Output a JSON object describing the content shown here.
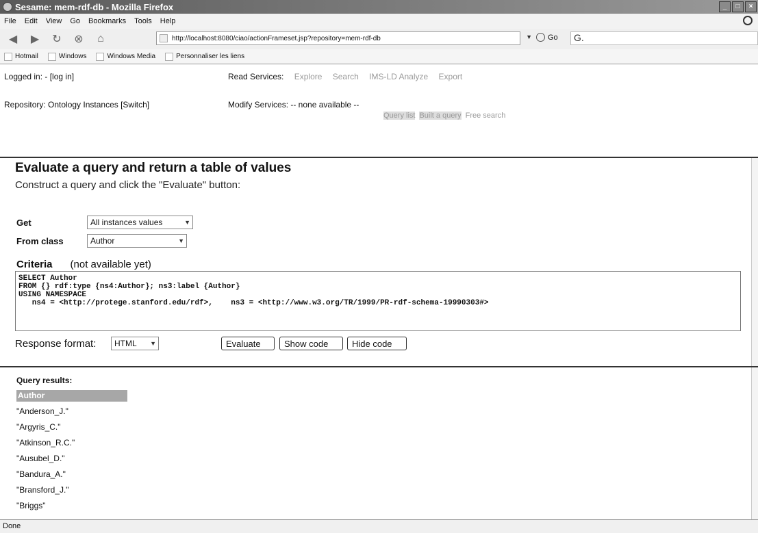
{
  "window": {
    "title": "Sesame: mem-rdf-db - Mozilla Firefox"
  },
  "menu": [
    "File",
    "Edit",
    "View",
    "Go",
    "Bookmarks",
    "Tools",
    "Help"
  ],
  "nav": {
    "url": "http://localhost:8080/ciao/actionFrameset.jsp?repository=mem-rdf-db",
    "go_label": "Go",
    "search_value": "G."
  },
  "bookmarks": [
    "Hotmail",
    "Windows",
    "Windows Media",
    "Personnaliser les liens"
  ],
  "header": {
    "logged_in": "Logged in: - [log in]",
    "repository": "Repository: Ontology Instances [Switch]",
    "read_services_label": "Read Services:",
    "read_services": [
      "Explore",
      "Search",
      "IMS-LD Analyze",
      "Export"
    ],
    "subtabs": [
      "Query list",
      "Built a query",
      "Free search"
    ],
    "modify_services": "Modify Services: -- none available --"
  },
  "query": {
    "heading": "Evaluate a query and return a table of values",
    "subheading": "Construct a query and click the \"Evaluate\" button:",
    "get_label": "Get",
    "get_value": "All instances values",
    "from_label": "From class",
    "from_value": "Author",
    "criteria_label": "Criteria",
    "criteria_value": "(not available yet)",
    "code": "SELECT Author\nFROM {} rdf:type {ns4:Author}; ns3:label {Author}\nUSING NAMESPACE\n   ns4 = <http://protege.stanford.edu/rdf>,    ns3 = <http://www.w3.org/TR/1999/PR-rdf-schema-19990303#>",
    "response_label": "Response format:",
    "response_value": "HTML",
    "evaluate_label": "Evaluate",
    "show_code_label": "Show code",
    "hide_code_label": "Hide code"
  },
  "results": {
    "title": "Query results:",
    "column": "Author",
    "rows": [
      "\"Anderson_J.\"",
      "\"Argyris_C.\"",
      "\"Atkinson_R.C.\"",
      "\"Ausubel_D.\"",
      "\"Bandura_A.\"",
      "\"Bransford_J.\"",
      "\"Briggs\""
    ]
  },
  "status": "Done"
}
